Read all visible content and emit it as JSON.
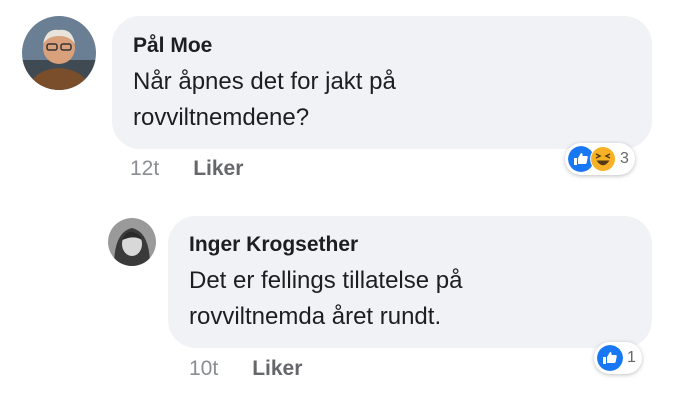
{
  "comments": [
    {
      "author": "Pål Moe",
      "text_lines": [
        "Når åpnes det for jakt på",
        "rovviltnemdene?"
      ],
      "time": "12t",
      "like_label": "Liker",
      "reaction_icons": [
        "like-icon",
        "haha-icon"
      ],
      "reaction_count": "3"
    },
    {
      "author": "Inger Krogsether",
      "text_lines": [
        "Det er fellings tillatelse på",
        "rovviltnemda året rundt."
      ],
      "time": "10t",
      "like_label": "Liker",
      "reaction_icons": [
        "like-icon"
      ],
      "reaction_count": "1"
    }
  ],
  "colors": {
    "bubble": "#f0f2f5",
    "like_blue": "#1877f2",
    "haha_yellow": "#f7b125",
    "meta_gray": "#65676b"
  }
}
